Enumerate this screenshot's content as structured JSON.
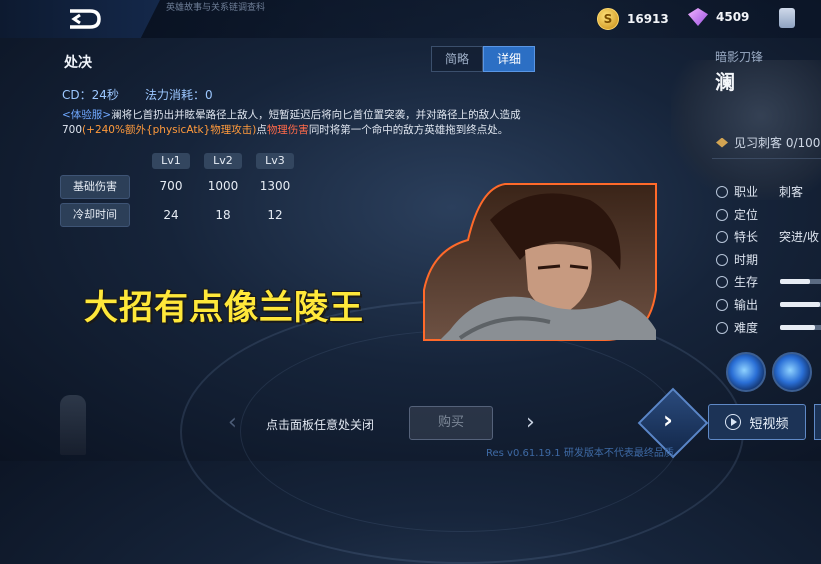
{
  "topbar": {
    "faded_title": "英雄故事与关系链调查科",
    "currency": [
      {
        "icon": "gold-coin-icon",
        "value": "16913"
      },
      {
        "icon": "diamond-icon",
        "value": "4509"
      }
    ]
  },
  "skill": {
    "name": "处决",
    "tabs": [
      "简略",
      "详细"
    ],
    "active_tab": "详细",
    "cd": "CD：24秒",
    "mana": "法力消耗：0",
    "desc_tag": "<体验服>",
    "desc_1": "澜将匕首扔出并眩晕路径上敌人，短暂延迟后将向匕首位置突袭，并对路径上的敌人造成700",
    "desc_2": "(+240%额外{physicAtk}物理攻击)",
    "desc_3": "点",
    "desc_4": "物理伤害",
    "desc_5": "同时将第一个命中的敌方英雄拖到终点处。",
    "levels": [
      "Lv1",
      "Lv2",
      "Lv3"
    ],
    "rows": [
      {
        "label": "基础伤害",
        "values": [
          "700",
          "1000",
          "1300"
        ]
      },
      {
        "label": "冷却时间",
        "values": [
          "24",
          "18",
          "12"
        ]
      }
    ]
  },
  "subtitle": "大招有点像兰陵王",
  "hero": {
    "title": "暗影刀锋",
    "name": "澜",
    "rank": "见习刺客 0/100",
    "attrs": [
      {
        "icon": "role-icon",
        "label": "职业",
        "value": "刺客"
      },
      {
        "icon": "position-icon",
        "label": "定位",
        "value": ""
      },
      {
        "icon": "trait-icon",
        "label": "特长",
        "value": "突进/收"
      },
      {
        "icon": "timing-icon",
        "label": "时期",
        "value": ""
      },
      {
        "icon": "survival-icon",
        "label": "生存",
        "value": "",
        "level": 0.6
      },
      {
        "icon": "damage-icon",
        "label": "输出",
        "value": "",
        "level": 0.8
      },
      {
        "icon": "difficulty-icon",
        "label": "难度",
        "value": "",
        "level": 0.7
      }
    ]
  },
  "bottom": {
    "close_hint": "点击面板任意处关闭",
    "buy": "购买",
    "video": "短视频",
    "res": "Res v0.61.19.1 研发版本不代表最终品质"
  }
}
